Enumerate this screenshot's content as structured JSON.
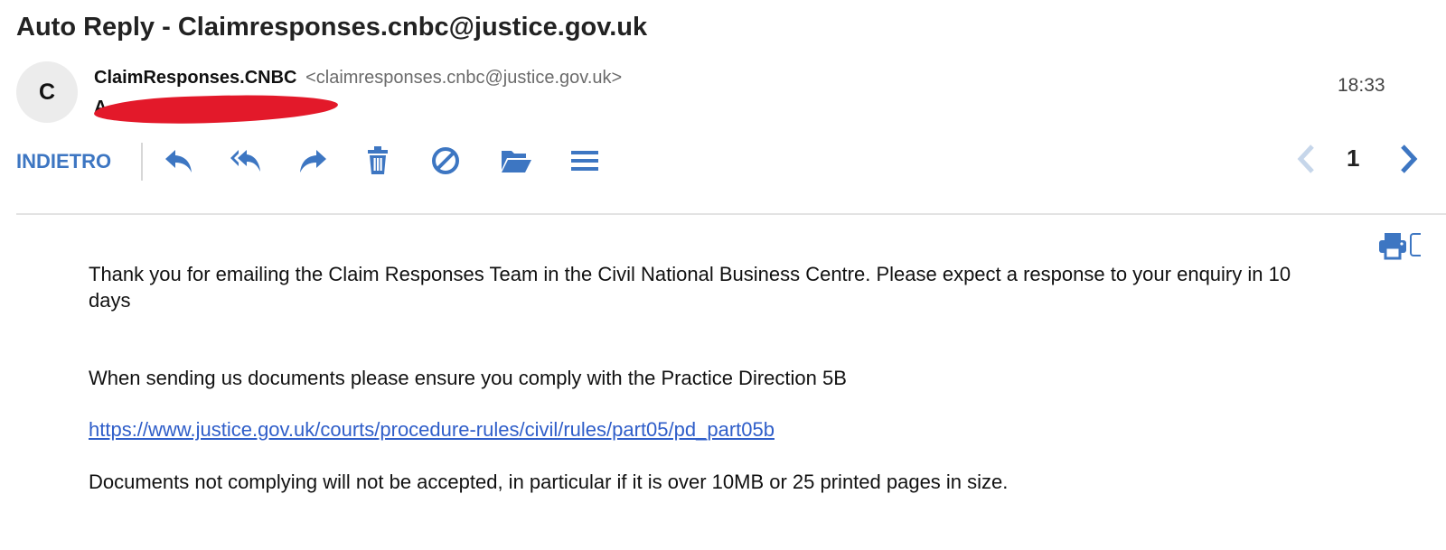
{
  "email": {
    "subject": "Auto Reply - Claimresponses.cnbc@justice.gov.uk",
    "avatar_letter": "C",
    "sender_name": "ClaimResponses.CNBC",
    "sender_email": "<claimresponses.cnbc@justice.gov.uk>",
    "recipient_visible": "A",
    "time": "18:33"
  },
  "toolbar": {
    "back_label": "INDIETRO",
    "icons": [
      "reply-icon",
      "reply-all-icon",
      "forward-icon",
      "trash-icon",
      "block-icon",
      "folder-icon",
      "menu-icon",
      "print-icon"
    ]
  },
  "pager": {
    "current": "1"
  },
  "body": {
    "paragraph1": "Thank you for emailing the Claim Responses Team in the Civil National Business Centre. Please expect a response to your enquiry in 10 days",
    "paragraph2": "When sending us documents please ensure you comply with the Practice Direction 5B",
    "link": "https://www.justice.gov.uk/courts/procedure-rules/civil/rules/part05/pd_part05b",
    "paragraph3": "Documents not complying will not be accepted, in particular if it is over 10MB or 25 printed pages in size."
  },
  "colors": {
    "accent": "#3d76c2",
    "link": "#2f5ec9",
    "redaction": "#e3192a",
    "avatar_bg": "#ececec"
  }
}
